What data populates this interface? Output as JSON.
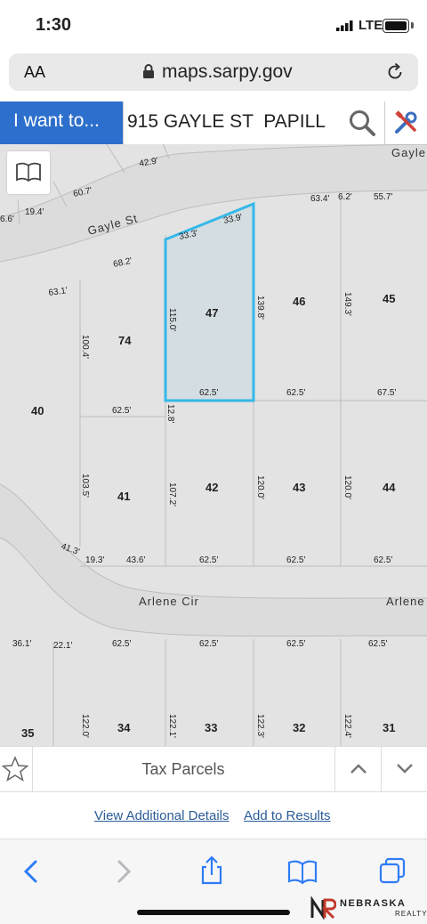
{
  "status_bar": {
    "time": "1:30",
    "network": "LTE"
  },
  "address_bar": {
    "text_size": "AA",
    "host": "maps.sarpy.gov"
  },
  "toolbar": {
    "i_want_label": "I want to...",
    "search_value": "915 GAYLE ST  PAPILL"
  },
  "map": {
    "streets": [
      "Gayle St",
      "Gayle",
      "Arlene Cir",
      "Arlene"
    ],
    "parcels": [
      "47",
      "46",
      "45",
      "74",
      "40",
      "41",
      "42",
      "43",
      "44",
      "35",
      "34",
      "33",
      "32",
      "31"
    ],
    "dimensions": {
      "d1": "42.9'",
      "d2": "60.7'",
      "d3": "6.6'",
      "d4": "19.4'",
      "d5": "63.4'",
      "d6": "6.2'",
      "d7": "55.7'",
      "d8": "33.3'",
      "d9": "33.9'",
      "d10": "68.2'",
      "d11": "63.1'",
      "d12": "115.0'",
      "d13": "139.8'",
      "d14": "149.3'",
      "d15": "100.4'",
      "d16": "62.5'",
      "d17": "62.5'",
      "d18": "67.5'",
      "d19": "62.5'",
      "d20": "12.8'",
      "d21": "103.5'",
      "d22": "107.2'",
      "d23": "120.0'",
      "d24": "120.0'",
      "d25": "41.3'",
      "d26": "19.3'",
      "d27": "43.6'",
      "d28": "62.5'",
      "d29": "62.5'",
      "d30": "62.5'",
      "d31": "36.1'",
      "d32": "22.1'",
      "d33": "62.5'",
      "d34": "62.5'",
      "d35": "62.5'",
      "d36": "62.5'",
      "d37": "122.0'",
      "d38": "122.1'",
      "d39": "122.3'",
      "d40": "122.4'"
    }
  },
  "panel": {
    "title": "Tax Parcels"
  },
  "links": {
    "details": "View Additional Details",
    "add": "Add to Results"
  },
  "watermark": {
    "brand": "NEBRASKA",
    "sub": "REALTY"
  },
  "icons": {
    "lock": "lock-icon",
    "reload": "reload-icon",
    "search": "magnifier-icon",
    "tools": "tools-icon",
    "book": "book-icon",
    "star": "star-icon",
    "up": "chevron-up-icon",
    "down": "chevron-down-icon",
    "back": "back-icon",
    "forward": "forward-icon",
    "share": "share-icon",
    "bookmarks": "bookmarks-icon",
    "tabs": "tabs-icon"
  },
  "colors": {
    "accent": "#2d6fcc",
    "selection": "#36b8e8",
    "link": "#2b5c98"
  }
}
